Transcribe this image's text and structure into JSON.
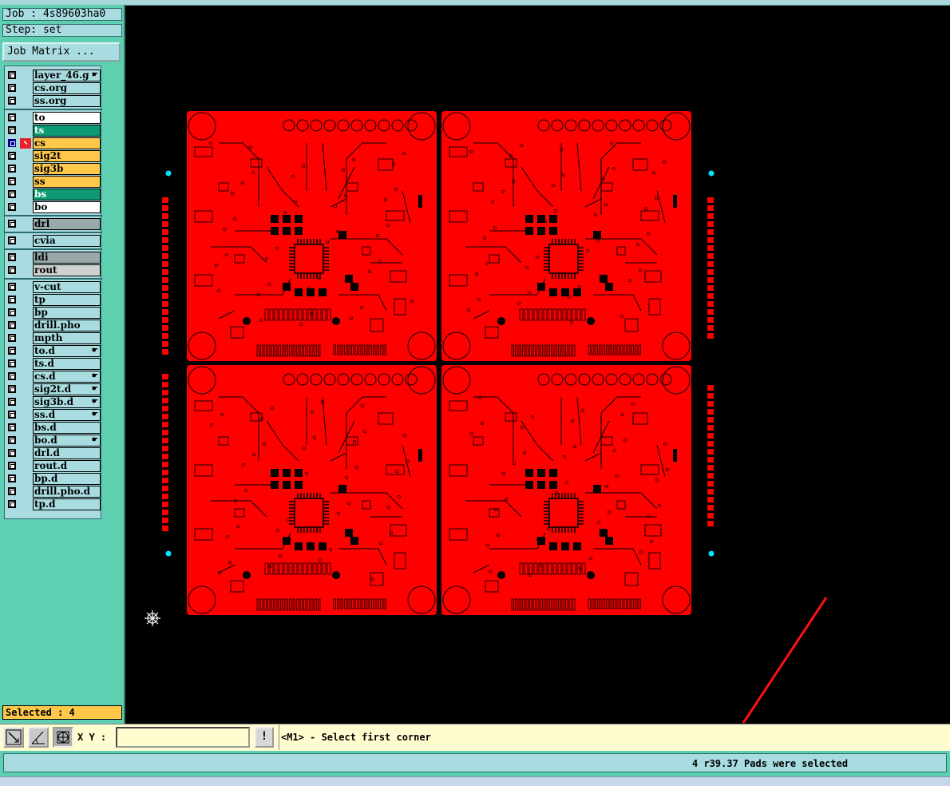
{
  "header": {
    "job_label": "Job : 4s89603ha0",
    "step_label": "Step: set",
    "job_matrix_button": "Job Matrix ..."
  },
  "layers": [
    {
      "name": "layer_46.g",
      "style": "default",
      "hand": true
    },
    {
      "name": "cs.org",
      "style": "default"
    },
    {
      "name": "ss.org",
      "style": "default"
    },
    {
      "name": "to",
      "style": "board-white"
    },
    {
      "name": "ts",
      "style": "board-green"
    },
    {
      "name": "cs",
      "style": "board-orange",
      "selected": true
    },
    {
      "name": "sig2t",
      "style": "board-orange"
    },
    {
      "name": "sig3b",
      "style": "board-orange"
    },
    {
      "name": "ss",
      "style": "board-orange"
    },
    {
      "name": "bs",
      "style": "board-green"
    },
    {
      "name": "bo",
      "style": "board-white"
    },
    {
      "name": "drl",
      "style": "board-gray"
    },
    {
      "name": "cvia",
      "style": "default"
    },
    {
      "name": "ldi",
      "style": "board-gray"
    },
    {
      "name": "rout",
      "style": "board-light"
    },
    {
      "name": "v-cut",
      "style": "default"
    },
    {
      "name": "tp",
      "style": "default"
    },
    {
      "name": "bp",
      "style": "default"
    },
    {
      "name": "drill.pho",
      "style": "default"
    },
    {
      "name": "mpth",
      "style": "default"
    },
    {
      "name": "to.d",
      "style": "default",
      "hand": true
    },
    {
      "name": "ts.d",
      "style": "default"
    },
    {
      "name": "cs.d",
      "style": "default",
      "hand": true
    },
    {
      "name": "sig2t.d",
      "style": "default",
      "hand": true
    },
    {
      "name": "sig3b.d",
      "style": "default",
      "hand": true
    },
    {
      "name": "ss.d",
      "style": "default",
      "hand": true
    },
    {
      "name": "bs.d",
      "style": "default"
    },
    {
      "name": "bo.d",
      "style": "default",
      "hand": true
    },
    {
      "name": "drl.d",
      "style": "default"
    },
    {
      "name": "rout.d",
      "style": "default"
    },
    {
      "name": "bp.d",
      "style": "default"
    },
    {
      "name": "drill.pho.d",
      "style": "default"
    },
    {
      "name": "tp.d",
      "style": "default"
    }
  ],
  "selected_label": "Selected : 4",
  "command": {
    "xy_label": "X Y :",
    "xy_value": "",
    "exclaim": "!",
    "prompt": "<M1> - Select first corner"
  },
  "status": {
    "message": "4 r39.37 Pads were selected"
  },
  "colors": {
    "panel": "#5ecfb0",
    "board": "#ff0000",
    "fiducial": "#00e5ff",
    "highlight": "#ffc84a"
  }
}
